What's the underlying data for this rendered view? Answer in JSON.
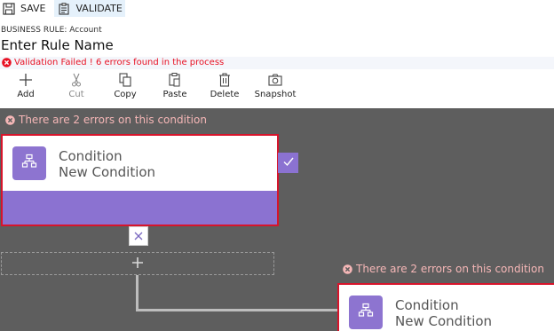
{
  "command_bar": {
    "save_label": "SAVE",
    "validate_label": "VALIDATE"
  },
  "business_rule": {
    "label": "BUSINESS RULE: Account",
    "name": "Enter Rule Name"
  },
  "validation": {
    "message": "Validation Failed ! 6 errors found in the process"
  },
  "toolbar": {
    "add": "Add",
    "cut": "Cut",
    "copy": "Copy",
    "paste": "Paste",
    "delete": "Delete",
    "snapshot": "Snapshot"
  },
  "canvas": {
    "condition1": {
      "error": "There are 2 errors on this condition",
      "title": "Condition",
      "subtitle": "New Condition"
    },
    "condition2": {
      "error": "There are 2 errors on this condition",
      "title": "Condition",
      "subtitle": "New Condition"
    }
  },
  "colors": {
    "accent_purple": "#8b72d1",
    "error_red": "#d7142b",
    "canvas_bg": "#5e5e5e"
  }
}
